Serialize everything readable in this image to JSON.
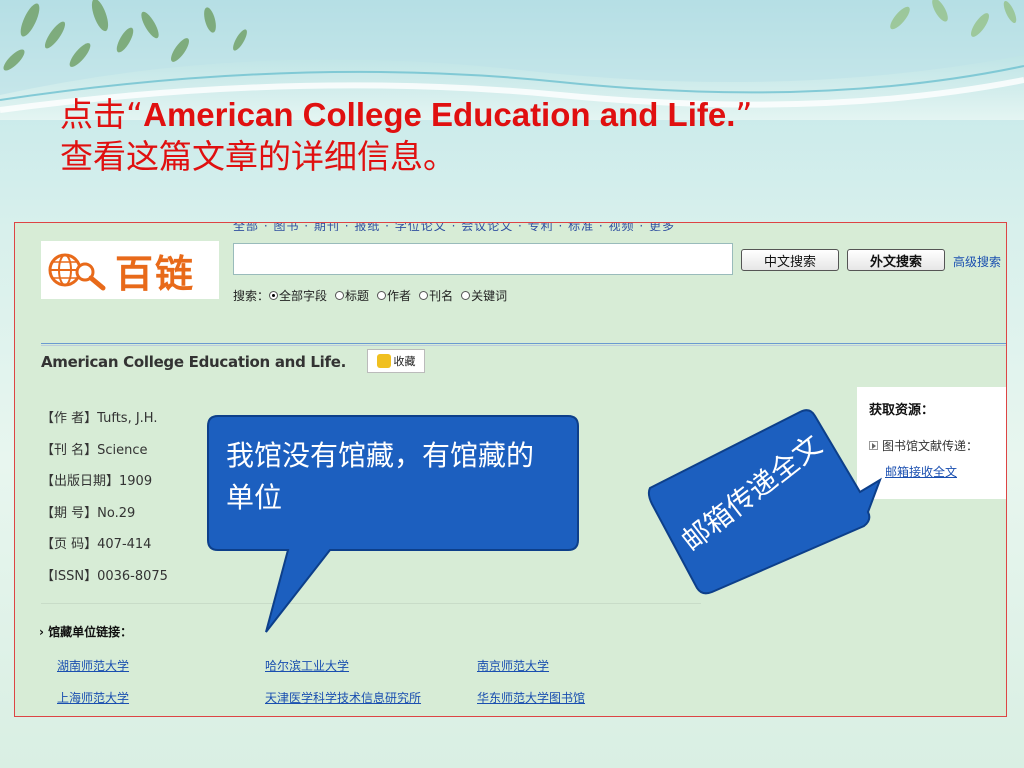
{
  "slide": {
    "title_prefix": "点击",
    "title_open_quote": "“",
    "title_english": "American College Education and Life.",
    "title_close_quote": "”",
    "title_line2": "查看这篇文章的详细信息。"
  },
  "portal": {
    "logo_text": "百链",
    "nav_text": "全部 · 图书 · 期刊 · 报纸 · 学位论文 · 会议论文 · 专利 · 标准 · 视频 · 更多",
    "search": {
      "value": "",
      "placeholder": ""
    },
    "btn_chinese_search": "中文搜索",
    "btn_foreign_search": "外文搜索",
    "advanced_search": "高级搜索",
    "scope_label": "搜索：",
    "scope_options": [
      "全部字段",
      "标题",
      "作者",
      "刊名",
      "关键词"
    ],
    "scope_selected": "全部字段"
  },
  "article": {
    "title": "American College Education and Life.",
    "favorite_label": "收藏",
    "meta": [
      {
        "label": "【作 者】",
        "value": "Tufts, J.H."
      },
      {
        "label": "【刊 名】",
        "value": "Science"
      },
      {
        "label": "【出版日期】",
        "value": "1909"
      },
      {
        "label": "【期 号】",
        "value": "No.29"
      },
      {
        "label": "【页 码】",
        "value": "407-414"
      },
      {
        "label": "【ISSN】",
        "value": "0036-8075"
      }
    ],
    "holdings_heading": "馆藏单位链接：",
    "holdings": [
      "湖南师范大学",
      "哈尔滨工业大学",
      "南京师范大学",
      "上海师范大学",
      "天津医学科学技术信息研究所",
      "华东师范大学图书馆"
    ]
  },
  "source_panel": {
    "title": "获取资源：",
    "delivery": "图书馆文献传递：",
    "email_link": "邮箱接收全文"
  },
  "callouts": {
    "no_holdings": "我馆没有馆藏，有馆藏的单位",
    "email_delivery": "邮箱传递全文"
  },
  "colors": {
    "title_red": "#e01010",
    "callout_blue": "#1c5fbf",
    "link_blue": "#1a4fb0",
    "page_green": "#d7ecd6"
  }
}
